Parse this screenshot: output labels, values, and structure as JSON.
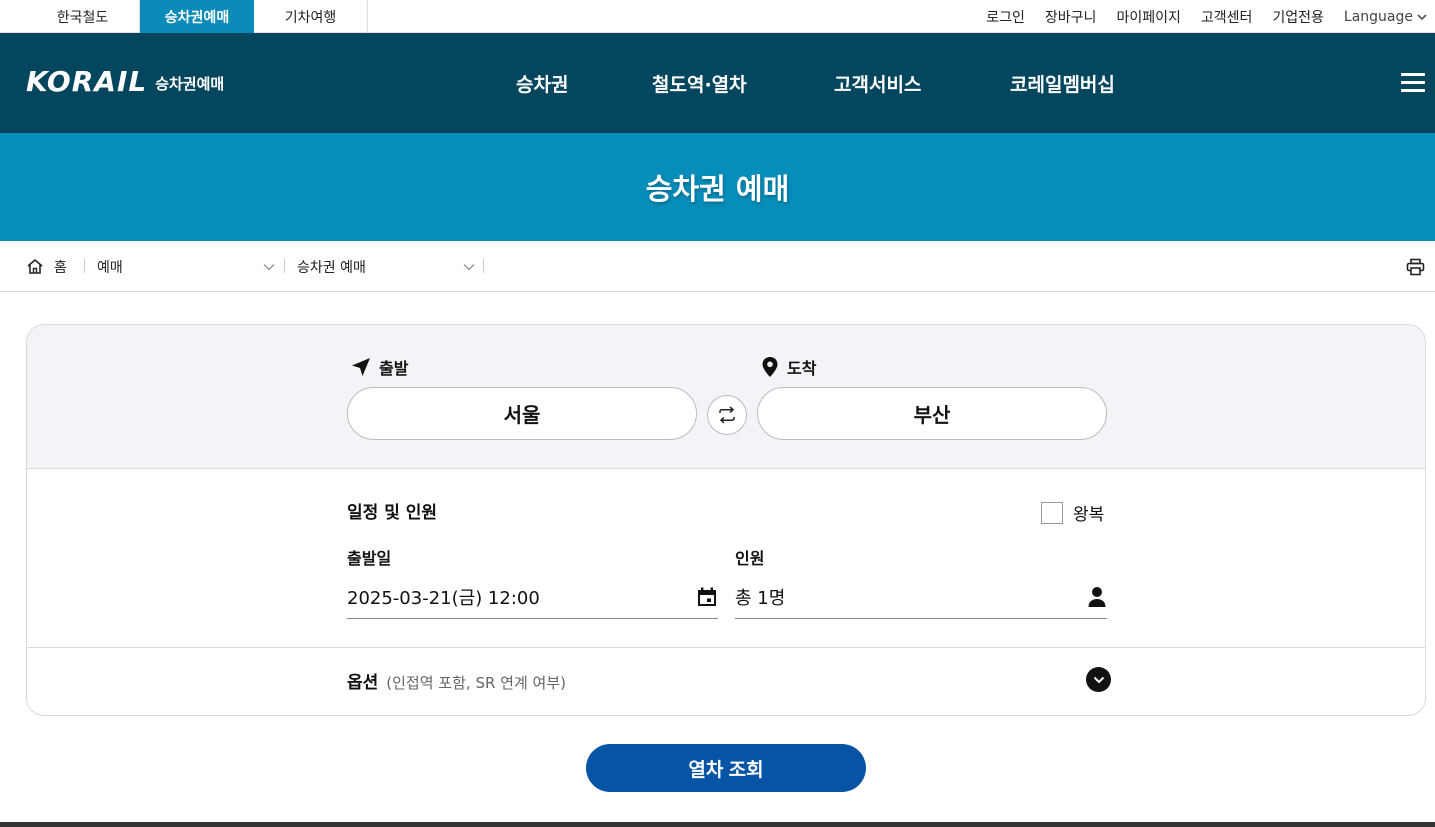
{
  "util_tabs": [
    "한국철도",
    "승차권예매",
    "기차여행"
  ],
  "util_links": {
    "login": "로그인",
    "cart": "장바구니",
    "mypage": "마이페이지",
    "support": "고객센터",
    "corporate": "기업전용",
    "language": "Language"
  },
  "header": {
    "logo": "KORAIL",
    "logo_sub": "승차권예매",
    "nav": [
      "승차권",
      "철도역·열차",
      "고객서비스",
      "코레일멤버십"
    ]
  },
  "banner_title": "승차권 예매",
  "breadcrumb": {
    "home": "홈",
    "level1": "예매",
    "level2": "승차권 예매"
  },
  "search": {
    "departure_label": "출발",
    "arrival_label": "도착",
    "departure_station": "서울",
    "arrival_station": "부산",
    "schedule_title": "일정 및 인원",
    "roundtrip_label": "왕복",
    "roundtrip_checked": false,
    "date_label": "출발일",
    "date_value": "2025-03-21(금) 12:00",
    "passengers_label": "인원",
    "passengers_value": "총 1명",
    "options_title": "옵션",
    "options_desc": "(인접역 포함, SR 연계 여부)",
    "submit_label": "열차 조회"
  },
  "colors": {
    "header_bg": "#03465e",
    "banner_bg": "#078dba",
    "active_tab": "#0a8ab8",
    "button": "#0654a6"
  }
}
